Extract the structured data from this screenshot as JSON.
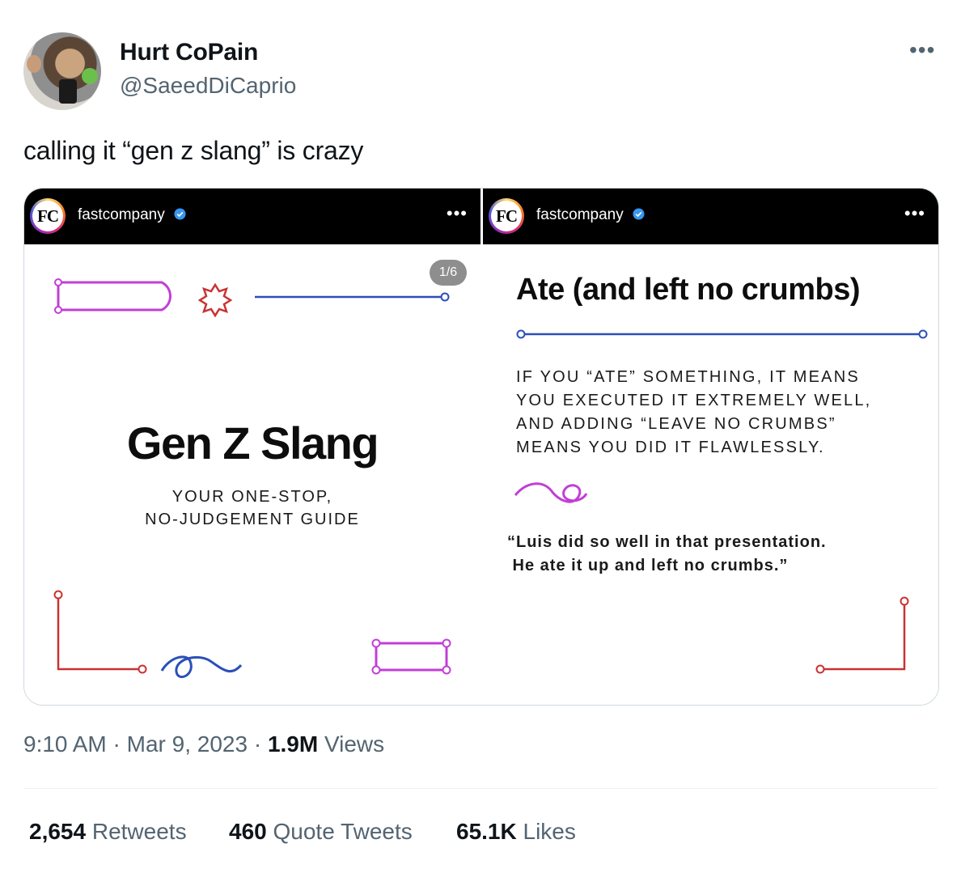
{
  "author": {
    "display_name": "Hurt CoPain",
    "handle": "@SaeedDiCaprio"
  },
  "tweet": {
    "text": "calling it “gen z slang” is crazy",
    "time": "9:10 AM",
    "date": "Mar 9, 2023",
    "views_count": "1.9M",
    "views_label": "Views"
  },
  "media": {
    "left": {
      "account": "fastcompany",
      "logo_text": "FC",
      "page_indicator": "1/6",
      "title": "Gen Z Slang",
      "subtitle_lines": [
        "YOUR ONE-STOP,",
        "NO-JUDGEMENT GUIDE"
      ]
    },
    "right": {
      "account": "fastcompany",
      "logo_text": "FC",
      "term": "Ate (and left no crumbs)",
      "definition_lines": [
        "IF YOU “ATE” SOMETHING, IT MEANS",
        "YOU EXECUTED IT EXTREMELY WELL,",
        "AND ADDING “LEAVE NO CRUMBS”",
        "MEANS YOU DID IT FLAWLESSLY."
      ],
      "example_lines": [
        "“Luis did so well in that presentation.",
        " He ate it up and left no crumbs.”"
      ]
    }
  },
  "stats": {
    "retweets_count": "2,654",
    "retweets_label": "Retweets",
    "quotes_count": "460",
    "quotes_label": "Quote Tweets",
    "likes_count": "65.1K",
    "likes_label": "Likes"
  },
  "colors": {
    "text_primary": "#0f1419",
    "text_secondary": "#536471",
    "verified_blue": "#1d9bf0",
    "deco_magenta": "#c13fd6",
    "deco_red": "#c93232",
    "deco_blue": "#2b4fb8"
  },
  "icons": [
    "more-horizontal-icon",
    "verified-badge-icon",
    "fastcompany-logo"
  ]
}
